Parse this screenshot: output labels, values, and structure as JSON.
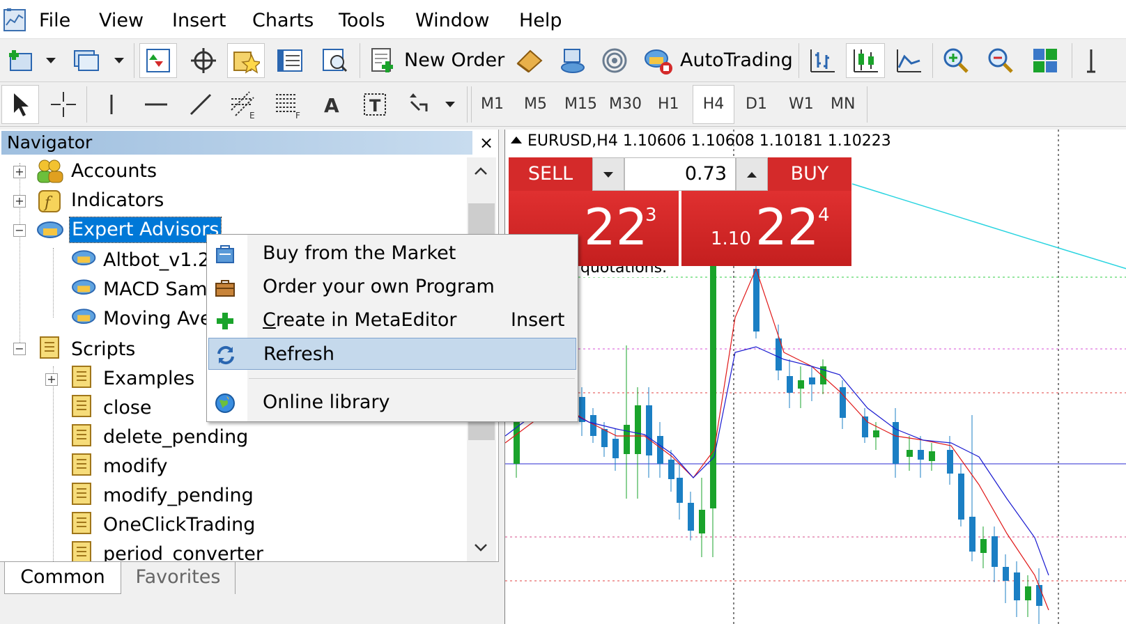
{
  "menubar": {
    "items": [
      "File",
      "View",
      "Insert",
      "Charts",
      "Tools",
      "Window",
      "Help"
    ]
  },
  "toolbar": {
    "new_order": "New Order",
    "autotrading": "AutoTrading"
  },
  "timeframes": [
    "M1",
    "M5",
    "M15",
    "M30",
    "H1",
    "H4",
    "D1",
    "W1",
    "MN"
  ],
  "timeframe_active": "H4",
  "navigator": {
    "title": "Navigator",
    "close": "×",
    "tree": {
      "accounts": "Accounts",
      "indicators": "Indicators",
      "expert_advisors": "Expert Advisors",
      "ea_items": [
        "Altbot_v1.2",
        "MACD Sam",
        "Moving Ave"
      ],
      "scripts": "Scripts",
      "script_items": [
        "Examples",
        "close",
        "delete_pending",
        "modify",
        "modify_pending",
        "OneClickTrading",
        "period_converter"
      ]
    },
    "tabs": [
      "Common",
      "Favorites"
    ]
  },
  "chart": {
    "header": "EURUSD,H4  1.10606 1.10608 1.10181 1.10223",
    "note_fragment": "quotations.",
    "one_click": {
      "sell": "SELL",
      "buy": "BUY",
      "lot": "0.73",
      "sell_price_big": "22",
      "sell_price_sup": "3",
      "buy_price_prefix": "1.10",
      "buy_price_big": "22",
      "buy_price_sup": "4"
    }
  },
  "context_menu": {
    "items": [
      {
        "label": "Buy from the Market"
      },
      {
        "label": "Order your own Program"
      },
      {
        "label": "Create in MetaEditor",
        "shortcut": "Insert"
      },
      {
        "label": "Refresh"
      },
      {
        "label": "Online library"
      }
    ]
  }
}
